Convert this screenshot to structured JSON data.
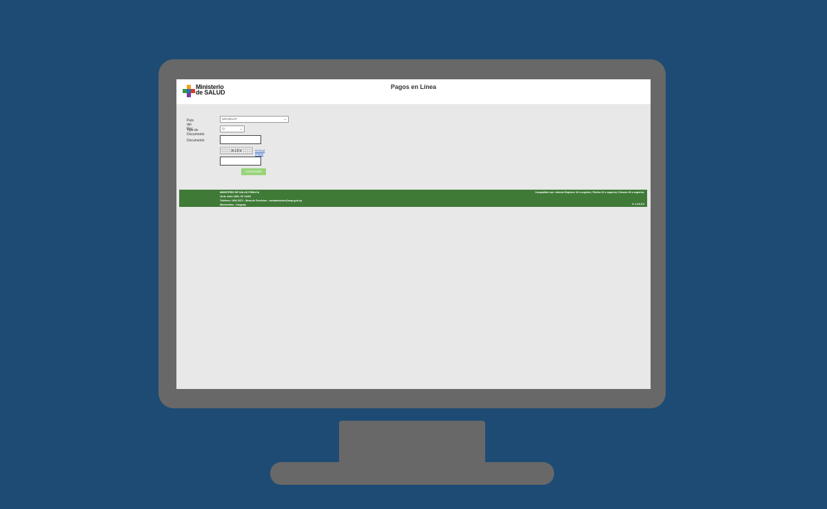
{
  "header": {
    "logo_line1": "Ministerio",
    "logo_line2": "de SALUD",
    "title": "Pagos en Línea"
  },
  "form": {
    "pais_label": "País del Doc.",
    "pais_value": "URUGUAY",
    "tipo_label": "Tipo de Documento",
    "tipo_value": "CI",
    "documento_label": "Documento",
    "documento_value": "",
    "captcha_text": "m c3 e",
    "reload_label": "Reload image",
    "captcha_value": "",
    "confirm_label": "CONFIRMAR"
  },
  "footer": {
    "line1": "MINISTERIO DE SALUD PÚBLICA",
    "line2": "18 de Julio 1892, CP 11200",
    "line3": "Teléfono: 1934 3372 - Mesa de Servicios - mesaatencion@msp.gub.uy",
    "line4": "Montevideo - Uruguay",
    "compat": "Compatible con: Internet Explorer 10 o superior, Firefox 22 o superior, Chrome 40 o superior.",
    "version": "V. 1.4.0.0.3"
  },
  "colors": {
    "background": "#1d4b74",
    "monitor": "#686868",
    "footer": "#3f7a37",
    "button": "#98d47c"
  }
}
